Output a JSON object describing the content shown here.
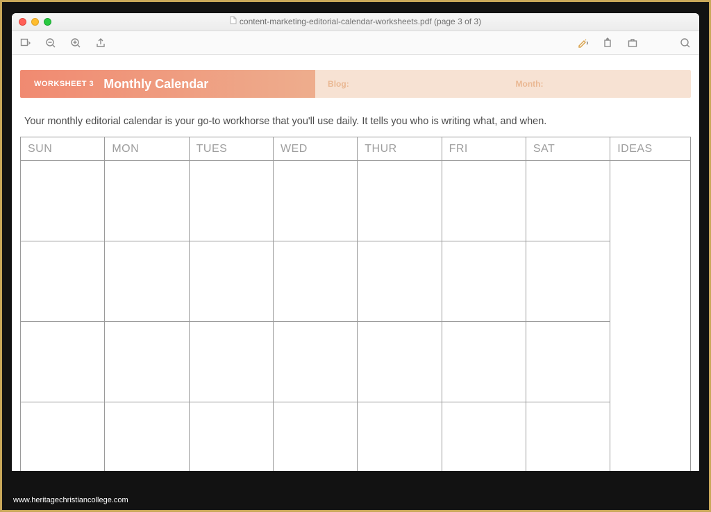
{
  "window": {
    "title": "content-marketing-editorial-calendar-worksheets.pdf (page 3 of 3)"
  },
  "document": {
    "worksheet_label": "WORKSHEET 3",
    "heading": "Monthly Calendar",
    "banner_blog_label": "Blog:",
    "banner_month_label": "Month:",
    "intro": "Your monthly editorial calendar is your go-to workhorse that you'll use daily. It tells you who is writing what, and when.",
    "columns": [
      "SUN",
      "MON",
      "TUES",
      "WED",
      "THUR",
      "FRI",
      "SAT",
      "IDEAS"
    ]
  },
  "footer": {
    "watermark": "www.heritagechristiancollege.com"
  }
}
